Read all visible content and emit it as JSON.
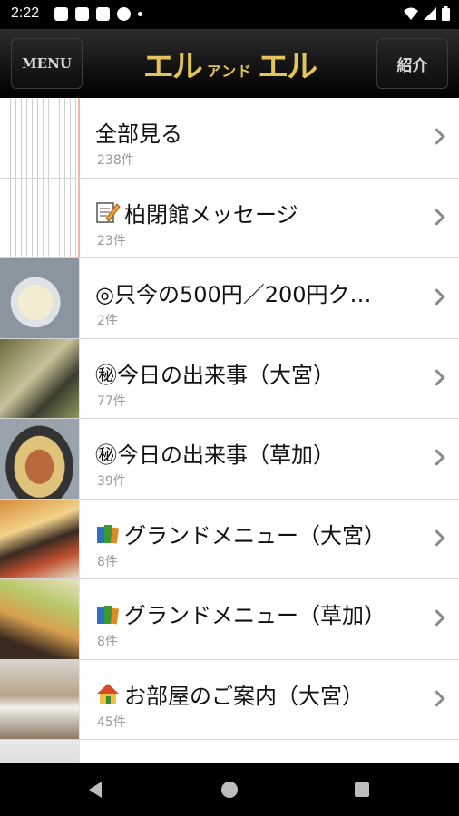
{
  "status": {
    "time": "2:22"
  },
  "header": {
    "menu_label": "MENU",
    "logo_left": "エル",
    "logo_mid": "アンド",
    "logo_right": "エル",
    "intro_label": "紹介"
  },
  "list": {
    "items": [
      {
        "title": "全部見る",
        "count": "238件",
        "icon": ""
      },
      {
        "title": "柏閉館メッセージ",
        "count": "23件",
        "icon": "memo-icon"
      },
      {
        "title": "◎只今の500円／200円ク…",
        "count": "2件",
        "icon": ""
      },
      {
        "title": "㊙今日の出来事（大宮）",
        "count": "77件",
        "icon": ""
      },
      {
        "title": "㊙今日の出来事（草加）",
        "count": "39件",
        "icon": ""
      },
      {
        "title": "グランドメニュー（大宮）",
        "count": "8件",
        "icon": "books-icon"
      },
      {
        "title": "グランドメニュー（草加）",
        "count": "8件",
        "icon": "books-icon"
      },
      {
        "title": "お部屋のご案内（大宮）",
        "count": "45件",
        "icon": "house-icon"
      }
    ]
  },
  "colors": {
    "header_bg": "#111111",
    "logo_gold": "#e2c45a",
    "count_gray": "#999999",
    "chevron_gray": "#8a8a8a"
  }
}
